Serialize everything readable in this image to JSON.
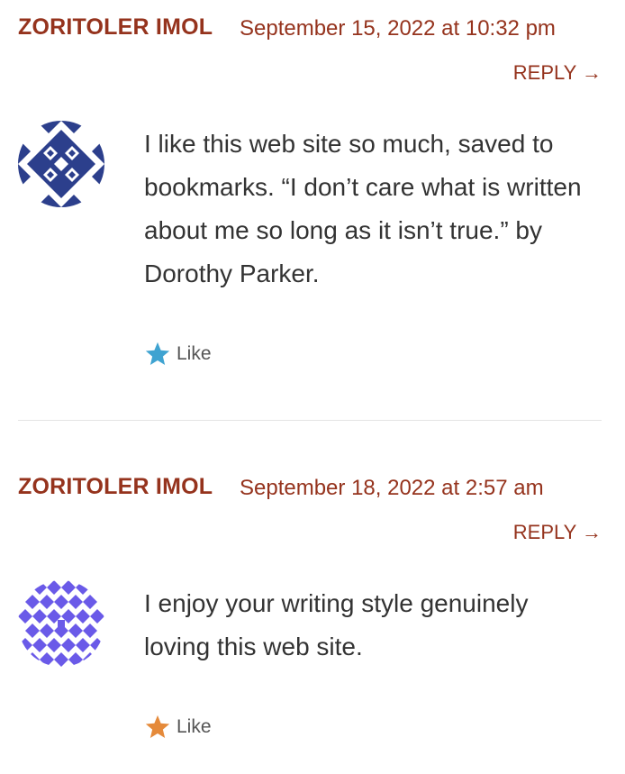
{
  "comments": [
    {
      "author": "ZORITOLER IMOL",
      "date": "September 15, 2022 at 10:32 pm",
      "reply_label": "REPLY →",
      "text": "I like this web site so much, saved to bookmarks. “I don’t care what is written about me so long as it isn’t true.” by Dorothy Parker.",
      "like_label": "Like",
      "star_color": "#3fa3d1",
      "avatar_color": "#2c3f8c"
    },
    {
      "author": "ZORITOLER IMOL",
      "date": "September 18, 2022 at 2:57 am",
      "reply_label": "REPLY →",
      "text": "I enjoy your writing style genuinely loving this web site.",
      "like_label": "Like",
      "star_color": "#e58a3a",
      "avatar_color": "#6a5ae8"
    }
  ]
}
